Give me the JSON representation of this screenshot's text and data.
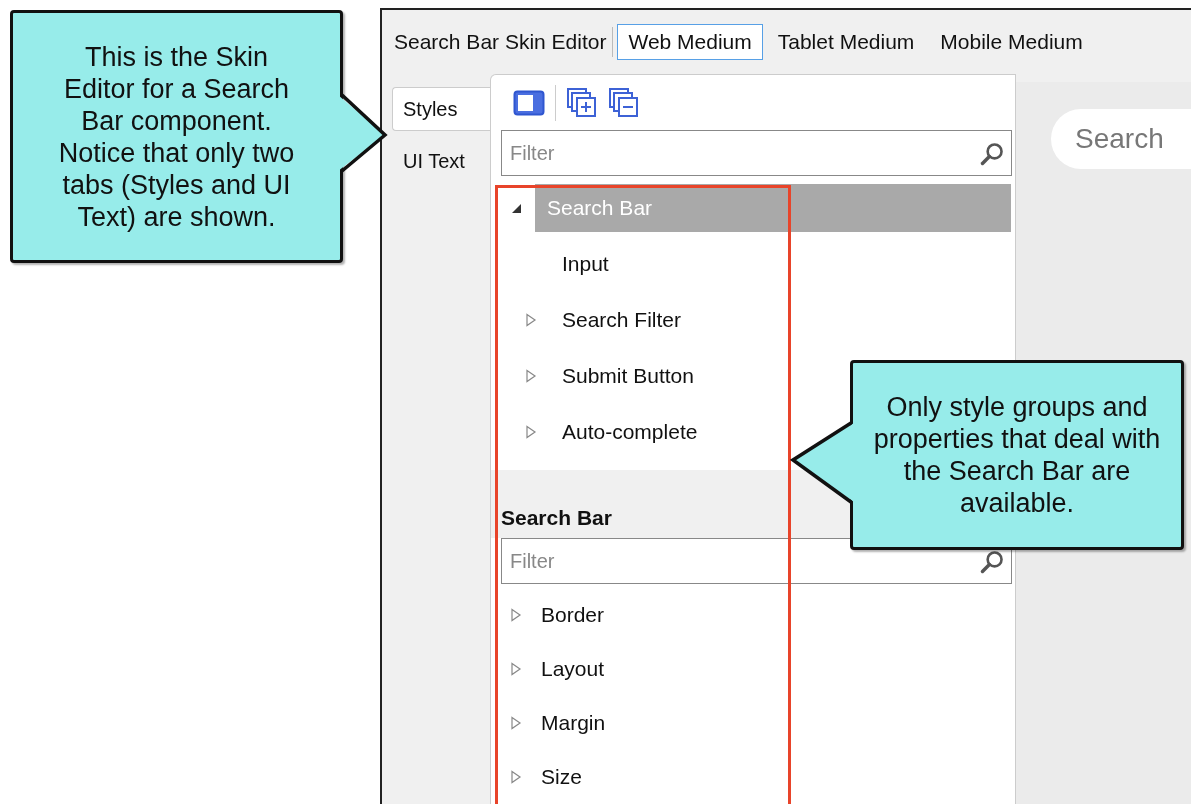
{
  "editor_title": "Search Bar Skin Editor",
  "device_tabs": [
    {
      "label": "Web Medium",
      "selected": true
    },
    {
      "label": "Tablet Medium",
      "selected": false
    },
    {
      "label": "Mobile Medium",
      "selected": false
    }
  ],
  "side_tabs": [
    {
      "label": "Styles",
      "selected": true
    },
    {
      "label": "UI Text",
      "selected": false
    }
  ],
  "style_filter": {
    "placeholder": "Filter"
  },
  "style_tree": [
    {
      "label": "Search Bar",
      "selected": true,
      "expanded": true,
      "children": [
        {
          "label": "Input",
          "selected": false
        },
        {
          "label": "Search Filter",
          "selected": false,
          "expanded": false
        },
        {
          "label": "Submit Button",
          "selected": false,
          "expanded": false
        },
        {
          "label": "Auto-complete",
          "selected": false,
          "expanded": false
        }
      ]
    }
  ],
  "properties": {
    "title": "Search Bar",
    "filter_placeholder": "Filter",
    "groups": [
      {
        "label": "Border",
        "expanded": false
      },
      {
        "label": "Layout",
        "expanded": false
      },
      {
        "label": "Margin",
        "expanded": false
      },
      {
        "label": "Size",
        "expanded": false
      }
    ]
  },
  "preview": {
    "search_placeholder": "Search"
  },
  "callouts": [
    {
      "text": "This is the Skin Editor for a Search Bar component. Notice that only two tabs (Styles and UI Text) are shown."
    },
    {
      "text": "Only style groups and properties that deal with the Search Bar are available."
    }
  ]
}
